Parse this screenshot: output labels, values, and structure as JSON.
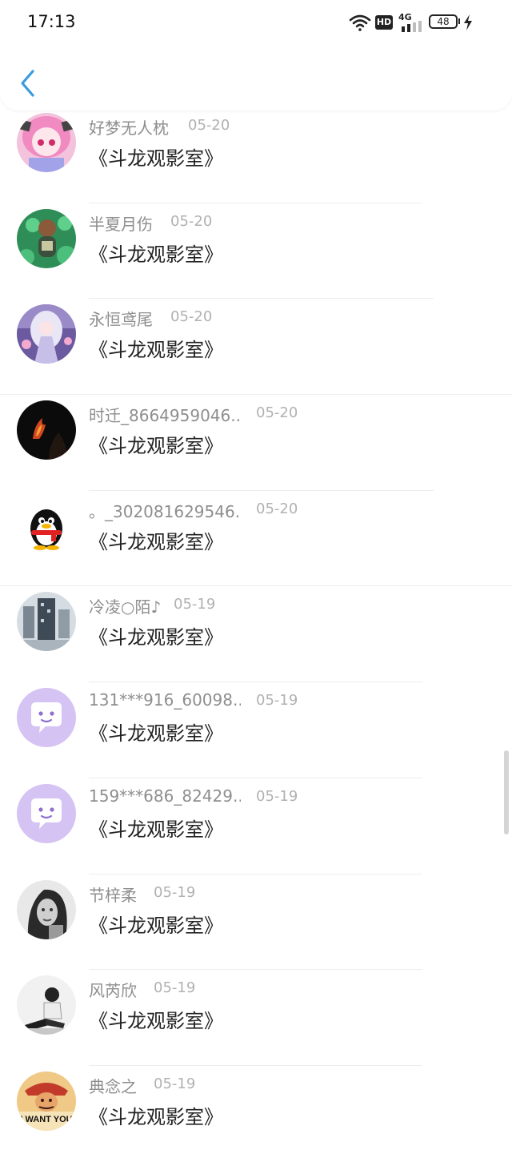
{
  "status_bar": {
    "time": "17:13",
    "hd": "HD",
    "net": "4G",
    "battery": "48"
  },
  "items": [
    {
      "name": "好梦无人枕",
      "date": "05-20",
      "title": "《斗龙观影室》",
      "avatar": "anime-pink-hair"
    },
    {
      "name": "半夏月伤",
      "date": "05-20",
      "title": "《斗龙观影室》",
      "avatar": "child-photo"
    },
    {
      "name": "永恒鸢尾",
      "date": "05-20",
      "title": "《斗龙观影室》",
      "avatar": "anime-white-hair"
    },
    {
      "name": "时迁_8664959046...",
      "date": "05-20",
      "title": "《斗龙观影室》",
      "avatar": "dark-fire"
    },
    {
      "name": "。_302081629546...",
      "date": "05-20",
      "title": "《斗龙观影室》",
      "avatar": "qq-penguin"
    },
    {
      "name": "冷凌○陌♪",
      "date": "05-19",
      "title": "《斗龙观影室》",
      "avatar": "city-scene"
    },
    {
      "name": "131***916_60098...",
      "date": "05-19",
      "title": "《斗龙观影室》",
      "avatar": "default-chat-bubble"
    },
    {
      "name": "159***686_82429...",
      "date": "05-19",
      "title": "《斗龙观影室》",
      "avatar": "default-chat-bubble"
    },
    {
      "name": "节梓柔",
      "date": "05-19",
      "title": "《斗龙观影室》",
      "avatar": "woman-portrait"
    },
    {
      "name": "风芮欣",
      "date": "05-19",
      "title": "《斗龙观影室》",
      "avatar": "person-sitting"
    },
    {
      "name": "典念之",
      "date": "05-19",
      "title": "《斗龙观影室》",
      "avatar": "i-want-you-poster",
      "avatar_text": "I WANT YOU"
    }
  ]
}
